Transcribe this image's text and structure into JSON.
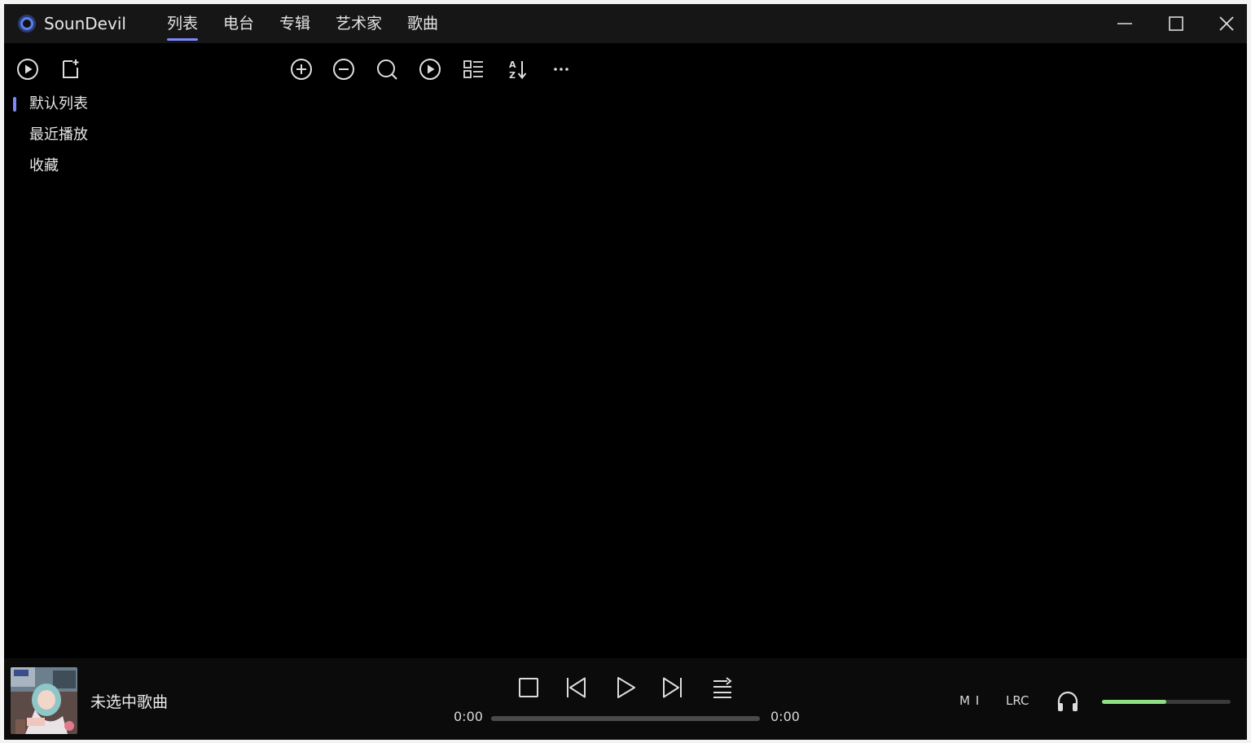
{
  "app": {
    "title": "SounDevil"
  },
  "nav": {
    "tabs": [
      {
        "label": "列表",
        "active": true
      },
      {
        "label": "电台",
        "active": false
      },
      {
        "label": "专辑",
        "active": false
      },
      {
        "label": "艺术家",
        "active": false
      },
      {
        "label": "歌曲",
        "active": false
      }
    ]
  },
  "window_controls": {
    "icons": [
      "minimize-icon",
      "maximize-icon",
      "close-icon"
    ]
  },
  "sidebar": {
    "toolbar_icons": [
      "play-circle-icon",
      "new-playlist-icon"
    ],
    "playlists": [
      {
        "label": "默认列表",
        "active": true
      },
      {
        "label": "最近播放",
        "active": false
      },
      {
        "label": "收藏",
        "active": false
      }
    ]
  },
  "toolbar": {
    "icons": [
      "add-circle-icon",
      "remove-circle-icon",
      "search-icon",
      "play-circle-icon",
      "list-view-icon",
      "sort-icon",
      "more-icon"
    ]
  },
  "player": {
    "song_title": "未选中歌曲",
    "elapsed": "0:00",
    "duration": "0:00",
    "progress": 0,
    "volume": 0.5,
    "mi_label": "M I",
    "lrc_label": "LRC",
    "icons": [
      "stop-icon",
      "previous-icon",
      "play-icon",
      "next-icon",
      "playlist-mode-icon",
      "headphones-icon"
    ]
  },
  "colors": {
    "accent": "#7d88ff",
    "volume": "#8ee082",
    "background": "#000000",
    "titlebar": "#161616",
    "playerbar": "#0b0b0b"
  }
}
